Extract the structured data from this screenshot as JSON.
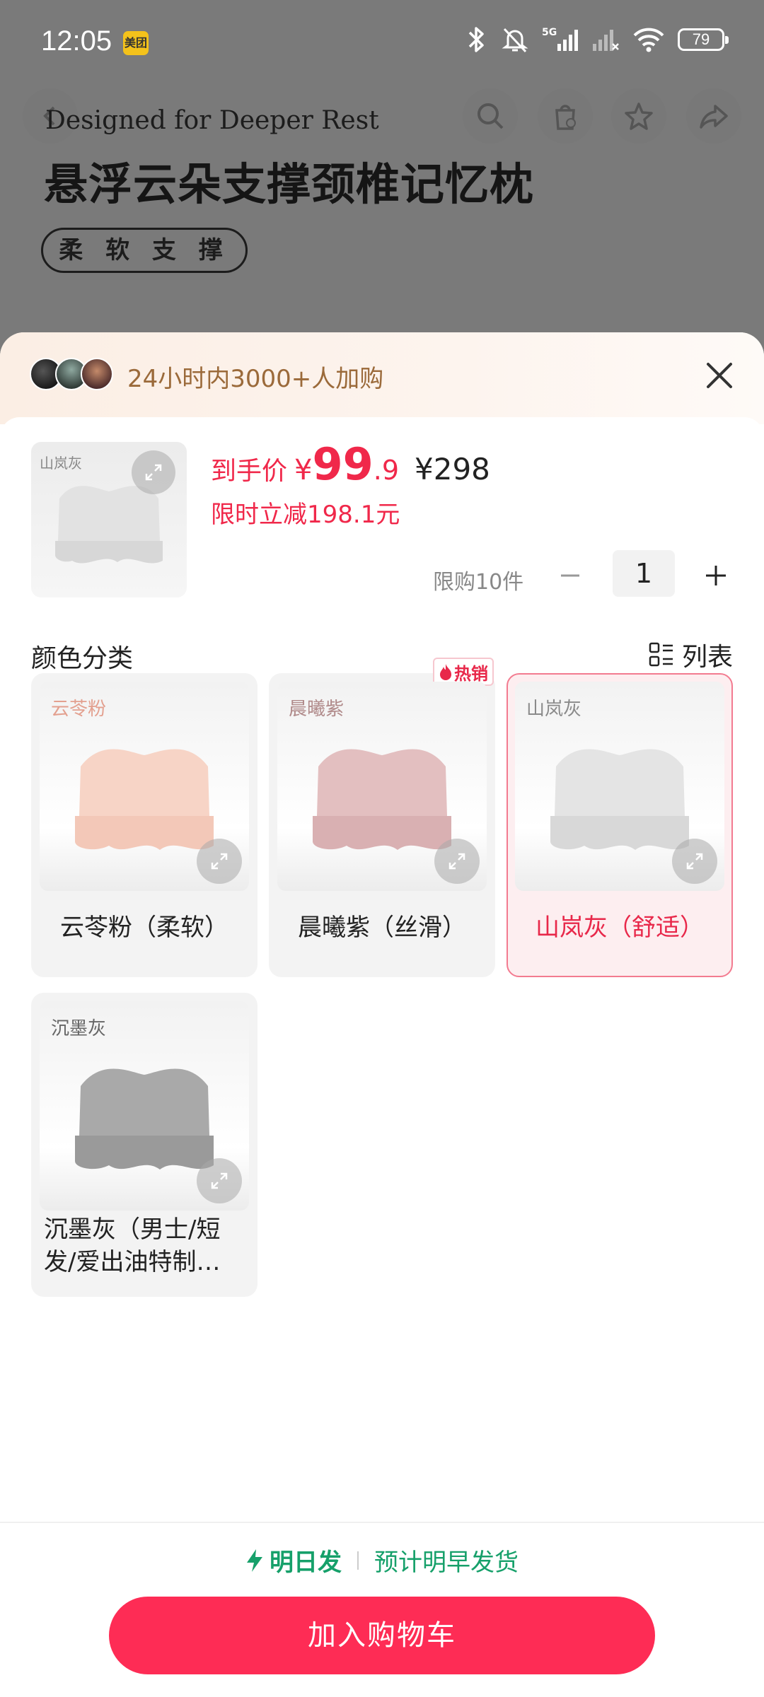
{
  "status_bar": {
    "time": "12:05",
    "app_badge": "美团",
    "network": "5G",
    "battery": "79"
  },
  "background_page": {
    "subtitle": "Designed for Deeper Rest",
    "title": "悬浮云朵支撑颈椎记忆枕",
    "tag": "柔 软 支 撑",
    "nav_icons": [
      "back-icon",
      "search-icon",
      "shop-icon",
      "favorite-icon",
      "share-icon"
    ]
  },
  "sheet": {
    "social_proof": "24小时内3000+人加购",
    "product": {
      "thumb_label": "山岚灰",
      "price_label": "到手价",
      "currency": "¥",
      "price_int": "99",
      "price_dec": ".9",
      "original_price": "¥298",
      "discount_text": "限时立减198.1元",
      "limit_text": "限购10件",
      "quantity": "1"
    },
    "section_title": "颜色分类",
    "view_toggle_label": "列表",
    "options": [
      {
        "image_label": "云苓粉",
        "label": "云苓粉（柔软）",
        "label_color": "#e3a08f",
        "selected": false,
        "hot": false
      },
      {
        "image_label": "晨曦紫",
        "label": "晨曦紫（丝滑）",
        "label_color": "#b08a8a",
        "selected": false,
        "hot": true,
        "hot_label": "热销"
      },
      {
        "image_label": "山岚灰",
        "label": "山岚灰（舒适）",
        "label_color": "#8a8a8a",
        "selected": true,
        "hot": false
      },
      {
        "image_label": "沉墨灰",
        "label": "沉墨灰（男士/短发/爱出油特制…",
        "label_color": "#666666",
        "selected": false,
        "hot": false
      }
    ],
    "shipping": {
      "fast_label": "明日发",
      "estimate": "预计明早发货"
    },
    "add_to_cart": "加入购物车"
  },
  "colors": {
    "accent": "#fe2c55",
    "price": "#f0284a",
    "shipping": "#16a06a"
  }
}
